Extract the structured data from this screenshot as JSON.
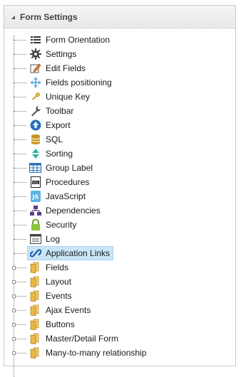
{
  "panel": {
    "title": "Form Settings"
  },
  "tree": {
    "items": [
      {
        "label": "Form Orientation",
        "icon": "list-lines-icon"
      },
      {
        "label": "Settings",
        "icon": "gear-icon"
      },
      {
        "label": "Edit Fields",
        "icon": "edit-fields-icon"
      },
      {
        "label": "Fields positioning",
        "icon": "move-arrows-icon"
      },
      {
        "label": "Unique Key",
        "icon": "key-icon"
      },
      {
        "label": "Toolbar",
        "icon": "wrench-icon"
      },
      {
        "label": "Export",
        "icon": "export-upload-icon"
      },
      {
        "label": "SQL",
        "icon": "database-icon"
      },
      {
        "label": "Sorting",
        "icon": "sort-arrows-icon"
      },
      {
        "label": "Group Label",
        "icon": "grid-table-icon"
      },
      {
        "label": "Procedures",
        "icon": "sql-file-icon"
      },
      {
        "label": "JavaScript",
        "icon": "javascript-icon"
      },
      {
        "label": "Dependencies",
        "icon": "hierarchy-icon"
      },
      {
        "label": "Security",
        "icon": "lock-icon"
      },
      {
        "label": "Log",
        "icon": "log-window-icon"
      },
      {
        "label": "Application Links",
        "icon": "chain-link-icon",
        "selected": true
      },
      {
        "label": "Fields",
        "icon": "folder-icon",
        "expandable": true
      },
      {
        "label": "Layout",
        "icon": "folder-icon",
        "expandable": true
      },
      {
        "label": "Events",
        "icon": "folder-icon",
        "expandable": true
      },
      {
        "label": "Ajax Events",
        "icon": "folder-icon",
        "expandable": true
      },
      {
        "label": "Buttons",
        "icon": "folder-icon",
        "expandable": true
      },
      {
        "label": "Master/Detail Form",
        "icon": "folder-icon",
        "expandable": true
      },
      {
        "label": "Many-to-many relationship",
        "icon": "folder-icon",
        "expandable": true
      }
    ]
  },
  "colors": {
    "selected_bg": "#c9e6f7",
    "header_bg": "#ececec",
    "folder": "#e8b84a",
    "blue_icon": "#2a73b8"
  }
}
